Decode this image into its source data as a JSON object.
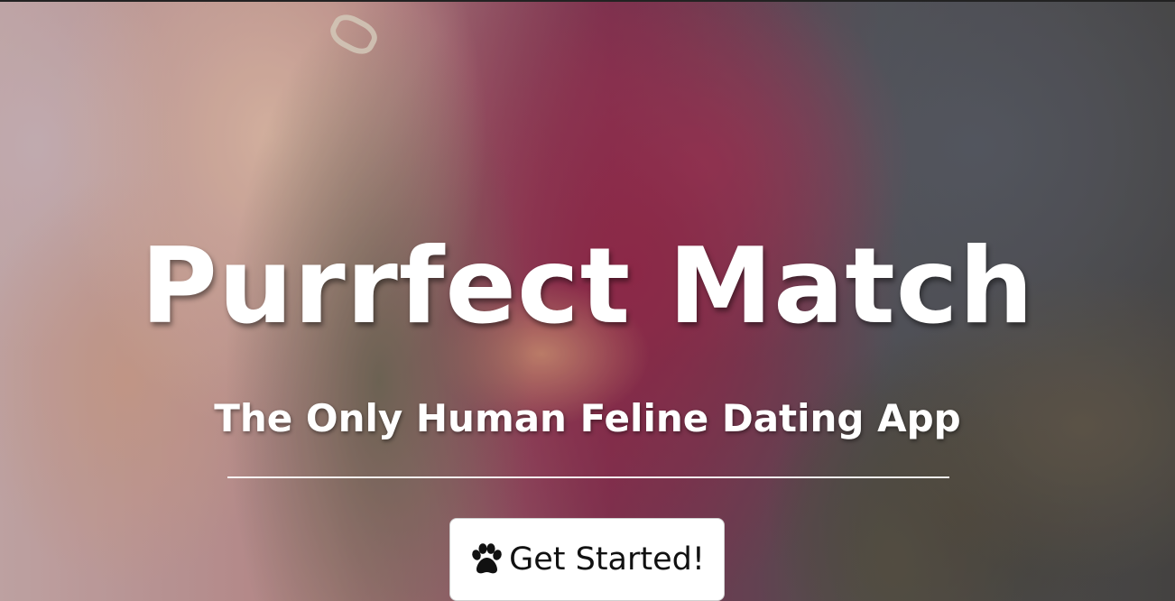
{
  "hero": {
    "title": "Purrfect Match",
    "subtitle": "The Only Human Feline Dating App",
    "cta": {
      "label": "Get Started!",
      "icon": "paw-icon"
    }
  }
}
